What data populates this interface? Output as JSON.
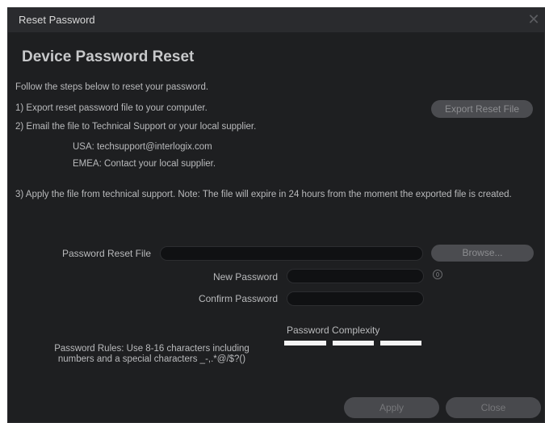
{
  "window": {
    "title": "Reset Password",
    "close_glyph": "✕"
  },
  "heading": "Device Password Reset",
  "intro": "Follow the steps below to reset your password.",
  "steps": {
    "step1": "1)  Export reset password file to your computer.",
    "step2": "2)  Email the file to Technical Support or your local supplier.",
    "usa": "USA: techsupport@interlogix.com",
    "emea": "EMEA: Contact your local supplier.",
    "step3": "3) Apply the file from technical support. Note:  The file will expire in 24 hours from the moment the exported file is created."
  },
  "buttons": {
    "export": "Export Reset File",
    "browse": "Browse...",
    "apply": "Apply",
    "close": "Close"
  },
  "fields": {
    "reset_file_label": "Password Reset File",
    "reset_file_value": "",
    "new_password_label": "New Password",
    "new_password_value": "",
    "confirm_password_label": "Confirm Password",
    "confirm_password_value": ""
  },
  "complexity": {
    "label": "Password Complexity",
    "level": 0
  },
  "rules": "Password Rules: Use 8-16 characters including numbers and a special characters  _-,.*@/$?()",
  "icons": {
    "close": "close-icon",
    "reveal": "eye-icon"
  },
  "colors": {
    "background": "#1e1f21",
    "titlebar": "#2a2b2e",
    "button": "#4b4c50",
    "field": "#101113",
    "complexity_bar": "#f4f4f4"
  }
}
